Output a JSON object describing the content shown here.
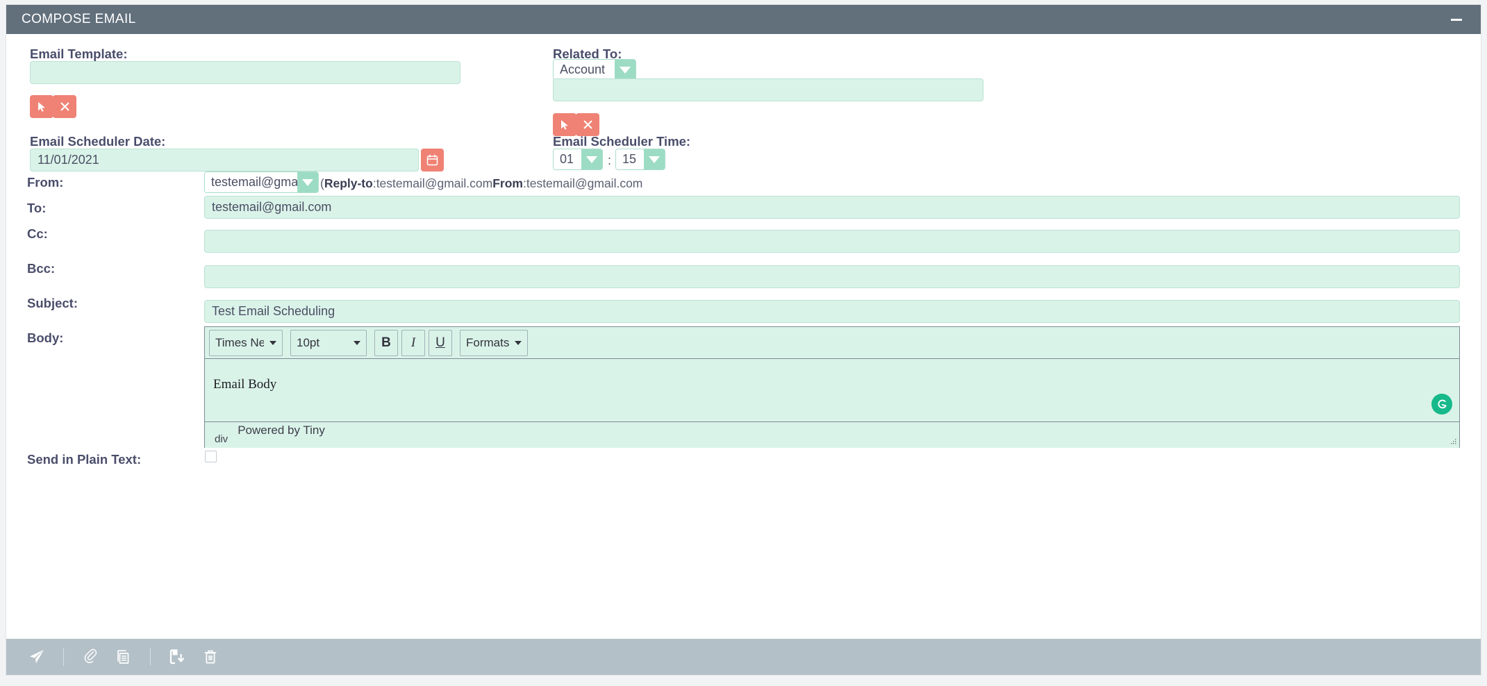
{
  "header": {
    "title": "COMPOSE EMAIL",
    "minimize_icon": "minus-icon"
  },
  "colors": {
    "header_bg": "#62707c",
    "field_bg": "#daf3e9",
    "field_border": "#b9e2d3",
    "accent_red": "#ef8274",
    "accent_mint": "#9ddcc4",
    "footer_bg": "#b4c0c7",
    "grammarly_green": "#17b98a"
  },
  "form": {
    "email_template": {
      "label": "Email Template:",
      "value": "",
      "select_button_icon": "cursor-arrow-icon",
      "clear_button_icon": "close-x-icon"
    },
    "related_to": {
      "label": "Related To:",
      "module_value": "Account",
      "module_options": [
        "Account"
      ],
      "record_value": "",
      "select_button_icon": "cursor-arrow-icon",
      "clear_button_icon": "close-x-icon"
    },
    "scheduler_date": {
      "label": "Email Scheduler Date:",
      "value": "11/01/2021",
      "calendar_button_icon": "calendar-icon"
    },
    "scheduler_time": {
      "label": "Email Scheduler Time:",
      "hour": "01",
      "separator": ":",
      "minute": "15"
    },
    "from": {
      "label": "From:",
      "value": "testemail@gmail.com",
      "note_prefix": "(",
      "note_reply_label": "Reply-to",
      "note_reply_value": ":testemail@gmail.com",
      "note_from_label": "From",
      "note_from_value": ":testemail@gmail.com"
    },
    "to": {
      "label": "To:",
      "value": "testemail@gmail.com"
    },
    "cc": {
      "label": "Cc:",
      "value": ""
    },
    "bcc": {
      "label": "Bcc:",
      "value": ""
    },
    "subject": {
      "label": "Subject:",
      "value": "Test Email Scheduling"
    },
    "body": {
      "label": "Body:",
      "toolbar": {
        "font_family": "Times New ...",
        "font_size": "10pt",
        "bold": "B",
        "italic": "I",
        "underline": "U",
        "formats": "Formats"
      },
      "content": "Email Body",
      "status_path": "div",
      "status_brand": "Powered by Tiny",
      "grammarly_icon": "grammarly-icon",
      "resize_icon": "resize-grip-icon"
    },
    "plain_text": {
      "label": "Send in Plain Text:",
      "checked": false
    }
  },
  "footer": {
    "actions": [
      {
        "name": "send",
        "icon": "paper-plane-icon"
      },
      {
        "name": "attach",
        "icon": "paperclip-icon"
      },
      {
        "name": "template",
        "icon": "documents-icon"
      },
      {
        "name": "save-draft",
        "icon": "save-floppy-icon"
      },
      {
        "name": "delete",
        "icon": "trash-icon"
      }
    ]
  }
}
